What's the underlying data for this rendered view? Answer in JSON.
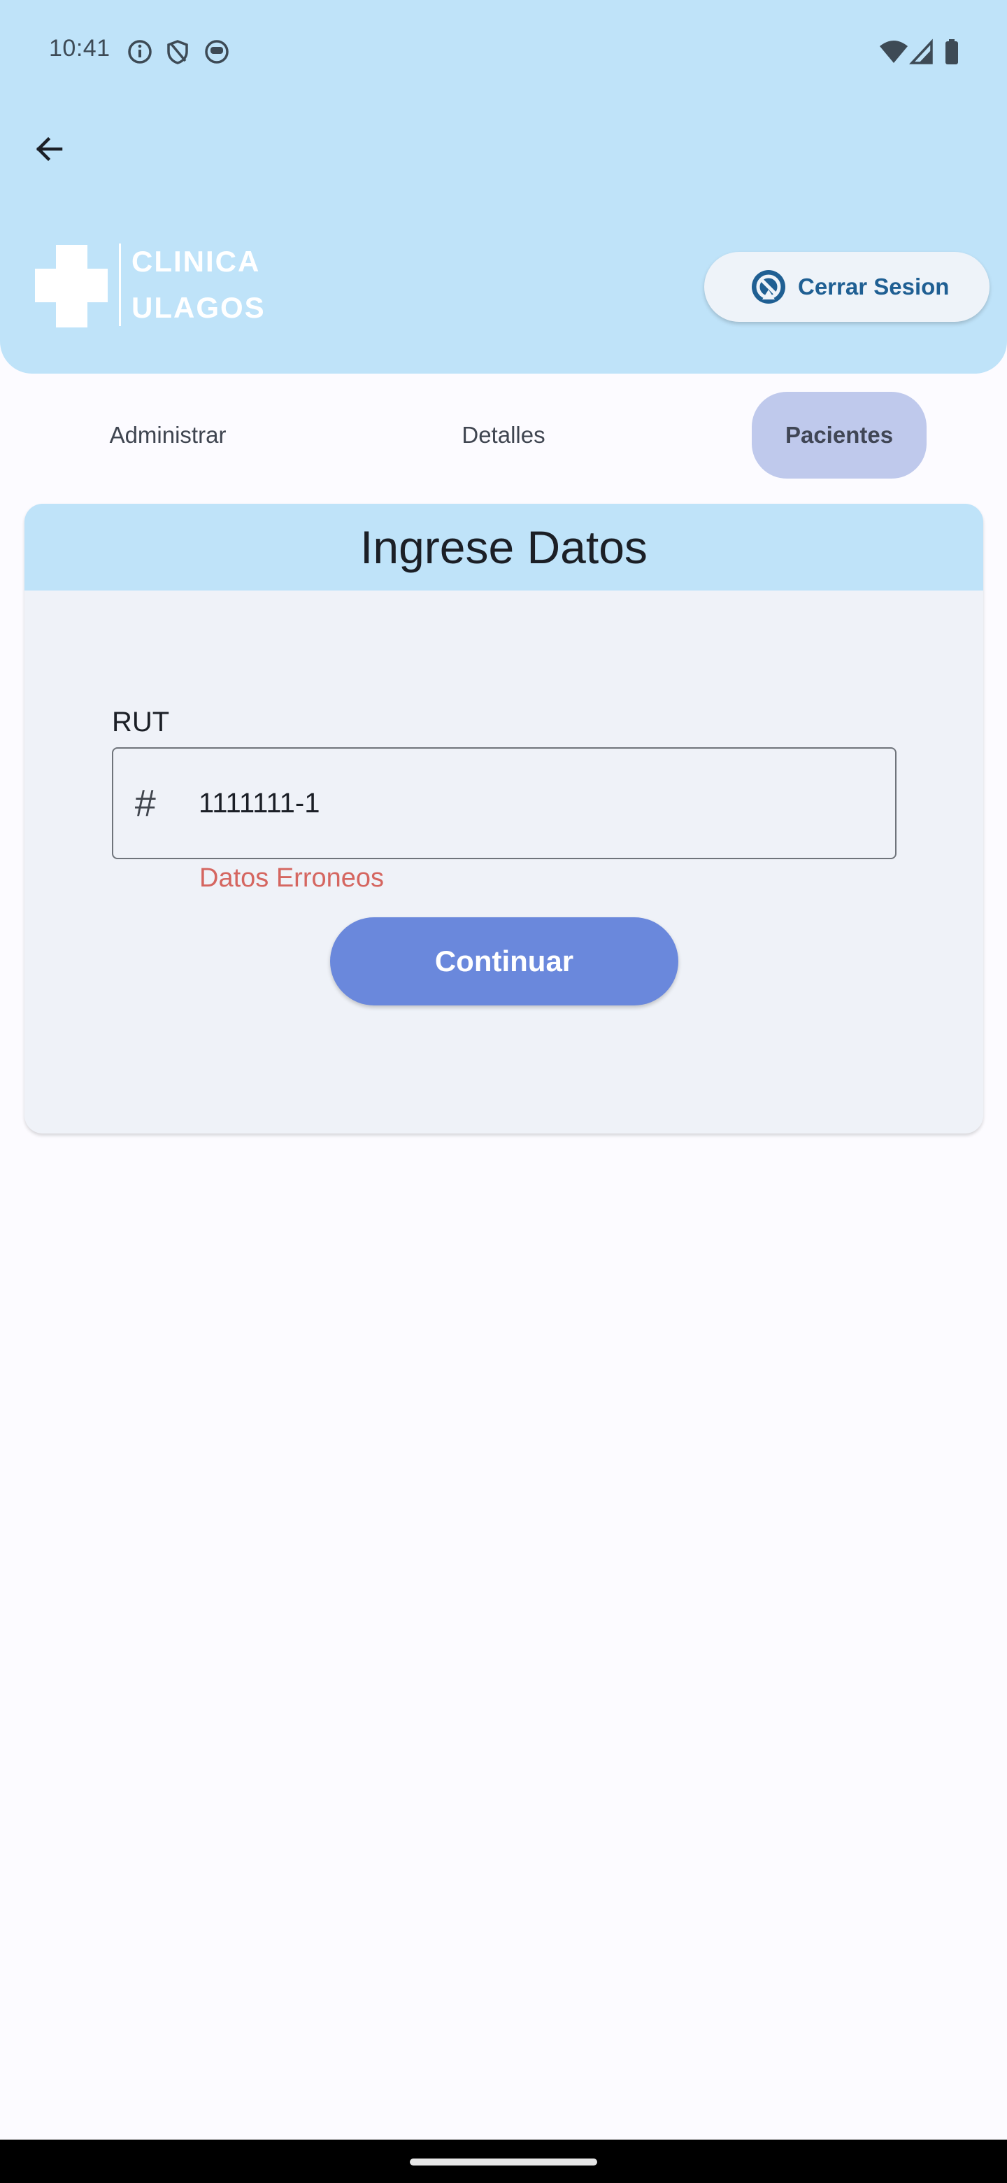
{
  "status_bar": {
    "time": "10:41",
    "left_icons": [
      "info-icon",
      "shield-icon",
      "assistant-icon"
    ],
    "right_icons": [
      "wifi-icon",
      "signal-icon",
      "battery-icon"
    ]
  },
  "header": {
    "back_icon": "arrow-left-icon",
    "logo": {
      "line1": "CLINICA",
      "line2": "ULAGOS"
    },
    "logout_button": {
      "label": "Cerrar Sesion",
      "icon": "logout-icon"
    }
  },
  "tabs": [
    {
      "label": "Administrar",
      "active": false
    },
    {
      "label": "Detalles",
      "active": false
    },
    {
      "label": "Pacientes",
      "active": true
    }
  ],
  "form": {
    "title": "Ingrese Datos",
    "rut_label": "RUT",
    "rut_icon": "hash-icon",
    "rut_value": "1111111-1",
    "error": "Datos Erroneos",
    "submit_label": "Continuar"
  },
  "colors": {
    "header_bg": "#bfe3f9",
    "active_tab": "#bfc9ec",
    "primary_button": "#6a88dc",
    "error": "#d56660",
    "logout_text": "#1f5f93"
  }
}
